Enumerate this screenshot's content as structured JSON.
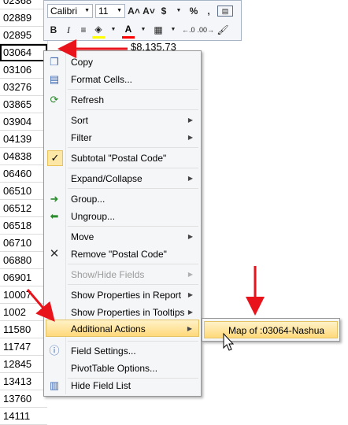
{
  "cells": [
    "02368",
    "02889",
    "02895",
    "03064",
    "03106",
    "03276",
    "03865",
    "03904",
    "04139",
    "04838",
    "06460",
    "06510",
    "06512",
    "06518",
    "06710",
    "06880",
    "06901",
    "10007",
    "1002",
    "11580",
    "11747",
    "12845",
    "13413",
    "13760",
    "14111",
    "14111"
  ],
  "selected_cell_index": 3,
  "adjacent_value": "$8,135.73",
  "mini_toolbar": {
    "font": "Calibri",
    "size": "11",
    "grow": "A˄",
    "shrink": "A˅",
    "currency": "$",
    "percent": "%",
    "comma": ",",
    "bold": "B",
    "italic": "I",
    "align": "≡",
    "font_color": "A",
    "inc_decimal": "‰0",
    "dec_decimal": ".00→.0"
  },
  "menu": {
    "copy": "Copy",
    "format_cells": "Format Cells...",
    "refresh": "Refresh",
    "sort": "Sort",
    "filter": "Filter",
    "subtotal": "Subtotal \"Postal Code\"",
    "expand_collapse": "Expand/Collapse",
    "group": "Group...",
    "ungroup": "Ungroup...",
    "move": "Move",
    "remove": "Remove \"Postal Code\"",
    "show_hide_fields": "Show/Hide Fields",
    "show_props_report": "Show Properties in Report",
    "show_props_tooltips": "Show Properties in Tooltips",
    "additional_actions": "Additional Actions",
    "field_settings": "Field Settings...",
    "pivottable_options": "PivotTable Options...",
    "hide_field_list": "Hide Field List"
  },
  "submenu": {
    "map": "Map of :03064-Nashua"
  },
  "colors": {
    "highlight": "#ffd97a",
    "annotation_arrow": "#e8131b",
    "menu_bg": "#f5f6f8"
  }
}
